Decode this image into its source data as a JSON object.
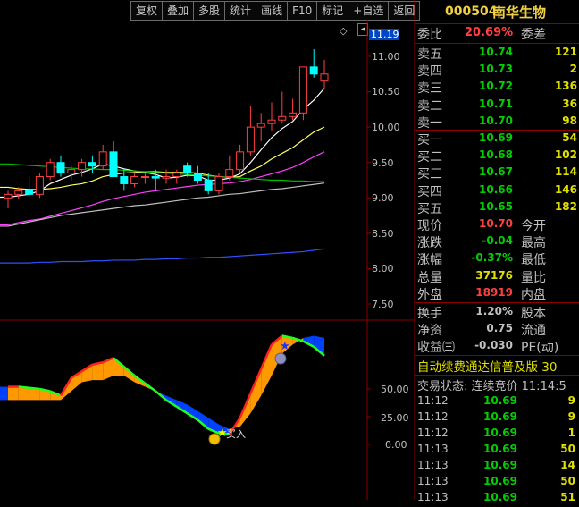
{
  "toolbar": [
    "复权",
    "叠加",
    "多股",
    "统计",
    "画线",
    "F10",
    "标记",
    "+自选",
    "返回"
  ],
  "price_axis": [
    "11.00",
    "10.50",
    "10.00",
    "9.50",
    "9.00",
    "8.50",
    "8.00",
    "7.50"
  ],
  "last_price_tag": "11.19",
  "diamond_icon": "◇",
  "scroll_icon": "◂",
  "indicator_axis": [
    "50.00",
    "25.00",
    "0.00"
  ],
  "buy_label": "买入",
  "colors": {
    "up": "#ff4040",
    "down": "#00ffff",
    "ma5": "#ffffff",
    "ma10": "#ffff60",
    "ma20": "#ff40ff",
    "ma30": "#00c000",
    "ma60": "#c0c0c0",
    "ma120": "#3050ff",
    "fill_orange": "#ff9900",
    "fill_blue": "#0040ff"
  },
  "chart_data": [
    {
      "type": "candlestick",
      "ylim": [
        7.3,
        11.3
      ],
      "candles": [
        {
          "o": 9.0,
          "h": 9.1,
          "l": 8.85,
          "c": 9.05
        },
        {
          "o": 9.05,
          "h": 9.15,
          "l": 8.98,
          "c": 9.1
        },
        {
          "o": 9.1,
          "h": 9.3,
          "l": 9.0,
          "c": 9.05
        },
        {
          "o": 9.05,
          "h": 9.35,
          "l": 9.0,
          "c": 9.3
        },
        {
          "o": 9.3,
          "h": 9.55,
          "l": 9.25,
          "c": 9.5
        },
        {
          "o": 9.5,
          "h": 9.6,
          "l": 9.3,
          "c": 9.35
        },
        {
          "o": 9.35,
          "h": 9.45,
          "l": 9.25,
          "c": 9.4
        },
        {
          "o": 9.4,
          "h": 9.55,
          "l": 9.3,
          "c": 9.5
        },
        {
          "o": 9.5,
          "h": 9.6,
          "l": 9.35,
          "c": 9.45
        },
        {
          "o": 9.45,
          "h": 9.75,
          "l": 9.4,
          "c": 9.65
        },
        {
          "o": 9.65,
          "h": 9.8,
          "l": 9.3,
          "c": 9.3
        },
        {
          "o": 9.3,
          "h": 9.4,
          "l": 9.1,
          "c": 9.2
        },
        {
          "o": 9.2,
          "h": 9.35,
          "l": 9.15,
          "c": 9.3
        },
        {
          "o": 9.3,
          "h": 9.35,
          "l": 9.2,
          "c": 9.3
        },
        {
          "o": 9.3,
          "h": 9.4,
          "l": 9.1,
          "c": 9.28
        },
        {
          "o": 9.28,
          "h": 9.4,
          "l": 9.2,
          "c": 9.3
        },
        {
          "o": 9.3,
          "h": 9.4,
          "l": 9.2,
          "c": 9.35
        },
        {
          "o": 9.45,
          "h": 9.5,
          "l": 9.3,
          "c": 9.35
        },
        {
          "o": 9.35,
          "h": 9.45,
          "l": 9.2,
          "c": 9.25
        },
        {
          "o": 9.25,
          "h": 9.35,
          "l": 9.05,
          "c": 9.1
        },
        {
          "o": 9.1,
          "h": 9.35,
          "l": 9.05,
          "c": 9.3
        },
        {
          "o": 9.3,
          "h": 9.6,
          "l": 9.25,
          "c": 9.4
        },
        {
          "o": 9.4,
          "h": 9.75,
          "l": 9.35,
          "c": 9.65
        },
        {
          "o": 9.65,
          "h": 10.3,
          "l": 9.6,
          "c": 10.0
        },
        {
          "o": 10.0,
          "h": 10.2,
          "l": 9.8,
          "c": 10.05
        },
        {
          "o": 10.05,
          "h": 10.35,
          "l": 9.95,
          "c": 10.1
        },
        {
          "o": 10.1,
          "h": 10.5,
          "l": 10.05,
          "c": 10.15
        },
        {
          "o": 10.15,
          "h": 10.4,
          "l": 10.1,
          "c": 10.2
        },
        {
          "o": 10.2,
          "h": 10.85,
          "l": 10.1,
          "c": 10.85
        },
        {
          "o": 10.85,
          "h": 11.1,
          "l": 10.7,
          "c": 10.75
        },
        {
          "o": 10.65,
          "h": 10.95,
          "l": 10.55,
          "c": 10.75
        }
      ],
      "series": [
        {
          "id": "ma5",
          "values": [
            9.01,
            9.03,
            9.05,
            9.1,
            9.2,
            9.26,
            9.32,
            9.36,
            9.41,
            9.48,
            9.45,
            9.41,
            9.38,
            9.36,
            9.33,
            9.28,
            9.29,
            9.32,
            9.31,
            9.25,
            9.25,
            9.28,
            9.34,
            9.5,
            9.68,
            9.85,
            9.98,
            10.08,
            10.25,
            10.38,
            10.55
          ]
        },
        {
          "id": "ma10",
          "values": [
            9.15,
            9.13,
            9.12,
            9.12,
            9.13,
            9.15,
            9.18,
            9.2,
            9.24,
            9.3,
            9.33,
            9.35,
            9.36,
            9.37,
            9.37,
            9.36,
            9.36,
            9.36,
            9.35,
            9.32,
            9.3,
            9.29,
            9.3,
            9.38,
            9.45,
            9.55,
            9.63,
            9.71,
            9.82,
            9.93,
            10.0
          ]
        },
        {
          "id": "ma20",
          "values": [
            8.62,
            8.65,
            8.68,
            8.7,
            8.74,
            8.78,
            8.82,
            8.86,
            8.9,
            8.95,
            8.99,
            9.02,
            9.05,
            9.08,
            9.1,
            9.12,
            9.14,
            9.16,
            9.18,
            9.19,
            9.2,
            9.21,
            9.23,
            9.26,
            9.3,
            9.34,
            9.38,
            9.43,
            9.5,
            9.58,
            9.65
          ]
        },
        {
          "id": "ma30",
          "values": [
            9.48,
            9.47,
            9.46,
            9.45,
            9.44,
            9.43,
            9.42,
            9.41,
            9.41,
            9.4,
            9.4,
            9.39,
            9.38,
            9.37,
            9.36,
            9.35,
            9.34,
            9.33,
            9.32,
            9.31,
            9.3,
            9.29,
            9.28,
            9.27,
            9.26,
            9.25,
            9.25,
            9.24,
            9.24,
            9.23,
            9.23
          ]
        },
        {
          "id": "ma60",
          "values": [
            8.6,
            8.63,
            8.66,
            8.69,
            8.72,
            8.75,
            8.77,
            8.79,
            8.81,
            8.83,
            8.85,
            8.87,
            8.89,
            8.9,
            8.92,
            8.94,
            8.96,
            8.98,
            9.0,
            9.01,
            9.03,
            9.05,
            9.06,
            9.08,
            9.1,
            9.12,
            9.13,
            9.15,
            9.17,
            9.19,
            9.21
          ]
        },
        {
          "id": "ma120",
          "values": [
            8.08,
            8.08,
            8.08,
            8.09,
            8.09,
            8.1,
            8.1,
            8.1,
            8.11,
            8.11,
            8.12,
            8.12,
            8.12,
            8.13,
            8.13,
            8.14,
            8.14,
            8.15,
            8.15,
            8.16,
            8.16,
            8.17,
            8.18,
            8.19,
            8.2,
            8.21,
            8.22,
            8.23,
            8.24,
            8.26,
            8.28
          ]
        }
      ]
    },
    {
      "type": "area",
      "ylim": [
        -10,
        110
      ],
      "series": [
        {
          "id": "fast",
          "values": [
            52,
            52,
            51,
            50,
            48,
            44,
            60,
            66,
            72,
            74,
            78,
            70,
            62,
            55,
            48,
            40,
            34,
            28,
            22,
            14,
            10,
            9,
            24,
            46,
            68,
            90,
            98,
            96,
            93,
            88,
            80
          ]
        },
        {
          "id": "slow",
          "values": [
            40,
            40,
            40,
            40,
            40,
            40,
            48,
            56,
            58,
            58,
            62,
            62,
            56,
            52,
            48,
            44,
            40,
            36,
            30,
            24,
            18,
            14,
            16,
            28,
            44,
            62,
            82,
            90,
            96,
            98,
            96
          ]
        }
      ]
    }
  ],
  "quote": {
    "code": "000504",
    "name": "南华生物",
    "weibi_label": "委比",
    "weibi": "20.69%",
    "weicha_label": "委差",
    "asks": [
      {
        "label": "卖五",
        "price": "10.74",
        "vol": "121"
      },
      {
        "label": "卖四",
        "price": "10.73",
        "vol": "2"
      },
      {
        "label": "卖三",
        "price": "10.72",
        "vol": "136"
      },
      {
        "label": "卖二",
        "price": "10.71",
        "vol": "36"
      },
      {
        "label": "卖一",
        "price": "10.70",
        "vol": "98"
      }
    ],
    "bids": [
      {
        "label": "买一",
        "price": "10.69",
        "vol": "54"
      },
      {
        "label": "买二",
        "price": "10.68",
        "vol": "102"
      },
      {
        "label": "买三",
        "price": "10.67",
        "vol": "114"
      },
      {
        "label": "买四",
        "price": "10.66",
        "vol": "146"
      },
      {
        "label": "买五",
        "price": "10.65",
        "vol": "182"
      }
    ],
    "stats": [
      {
        "l": "现价",
        "v": "10.70",
        "vc": "#ff4040",
        "l2": "今开"
      },
      {
        "l": "涨跌",
        "v": "-0.04",
        "vc": "#00d000",
        "l2": "最高"
      },
      {
        "l": "涨幅",
        "v": "-0.37%",
        "vc": "#00d000",
        "l2": "最低"
      },
      {
        "l": "总量",
        "v": "37176",
        "vc": "#e0e000",
        "l2": "量比"
      },
      {
        "l": "外盘",
        "v": "18919",
        "vc": "#ff4040",
        "l2": "内盘"
      }
    ],
    "stats2": [
      {
        "l": "换手",
        "v": "1.20%",
        "vc": "#c0c0c0",
        "l2": "股本"
      },
      {
        "l": "净资",
        "v": "0.75",
        "vc": "#c0c0c0",
        "l2": "流通"
      },
      {
        "l": "收益㈢",
        "v": "-0.030",
        "vc": "#c0c0c0",
        "l2": "PE(动)"
      }
    ],
    "ticker": "自动续费通达信普及版  30",
    "status": "交易状态: 连续竞价  11:14:5",
    "ticks": [
      {
        "t": "11:12",
        "p": "10.69",
        "v": "9"
      },
      {
        "t": "11:12",
        "p": "10.69",
        "v": "9"
      },
      {
        "t": "11:12",
        "p": "10.69",
        "v": "1"
      },
      {
        "t": "11:13",
        "p": "10.69",
        "v": "50"
      },
      {
        "t": "11:13",
        "p": "10.69",
        "v": "14"
      },
      {
        "t": "11:13",
        "p": "10.69",
        "v": "50"
      },
      {
        "t": "11:13",
        "p": "10.69",
        "v": "51"
      }
    ]
  }
}
